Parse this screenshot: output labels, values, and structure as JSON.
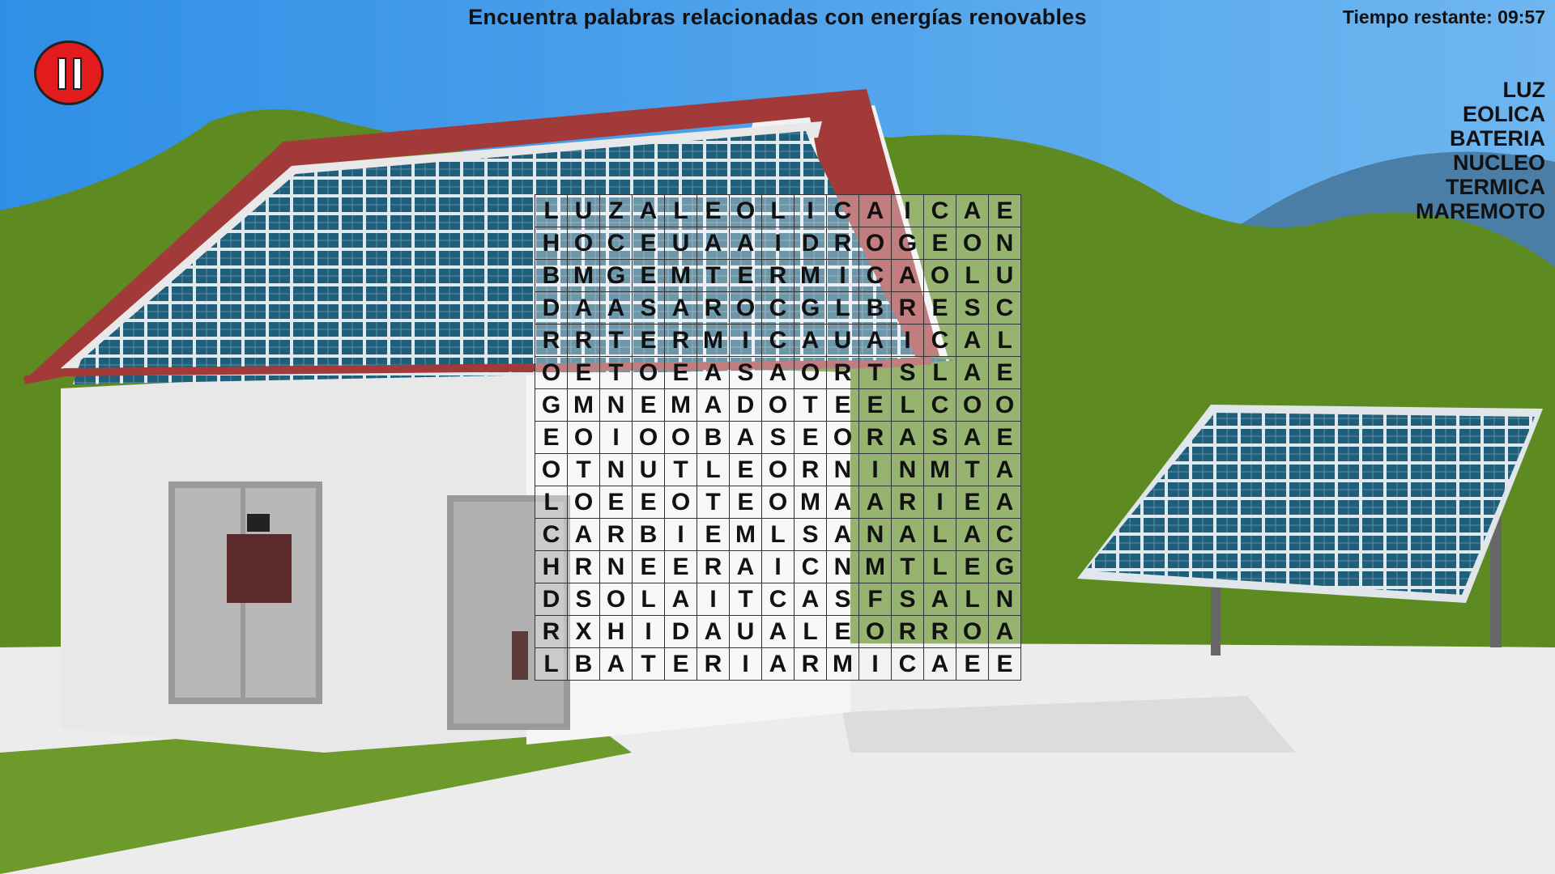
{
  "header": {
    "title": "Encuentra palabras relacionadas con energías renovables",
    "timer": "Tiempo restante: 09:57"
  },
  "pause_icon": "pause-icon",
  "words": [
    "LUZ",
    "EOLICA",
    "BATERIA",
    "NUCLEO",
    "TERMICA",
    "MAREMOTO"
  ],
  "grid": [
    "LUZALEOLICAICAE",
    "HOCEUAAIDROGEON",
    "BMGEMTERMICAOLU",
    "DAASAROCGLBRESC",
    "RRTERMICAUAICAL",
    "OETOEASAORTSLAE",
    "GMNEMADOTEELCOO",
    "EOIOOBASEORASAE",
    "OTNUTLEORNINMTA",
    "LOEEOTEOMAARIEA",
    "CARBIEMLSANALAC",
    "HRNEERAICNMTLEG",
    "DSOLAITCASFSALN",
    "RXHIDAUALEORROA",
    "LBATERIARMICAEE"
  ],
  "colors": {
    "sky": "#3a9df0",
    "hills": "#5e8a22",
    "roof": "#a23a3a",
    "panel": "#1f5f7a",
    "wall": "#e8e8e8",
    "ground": "#ececec",
    "pause": "#e21c1c"
  }
}
